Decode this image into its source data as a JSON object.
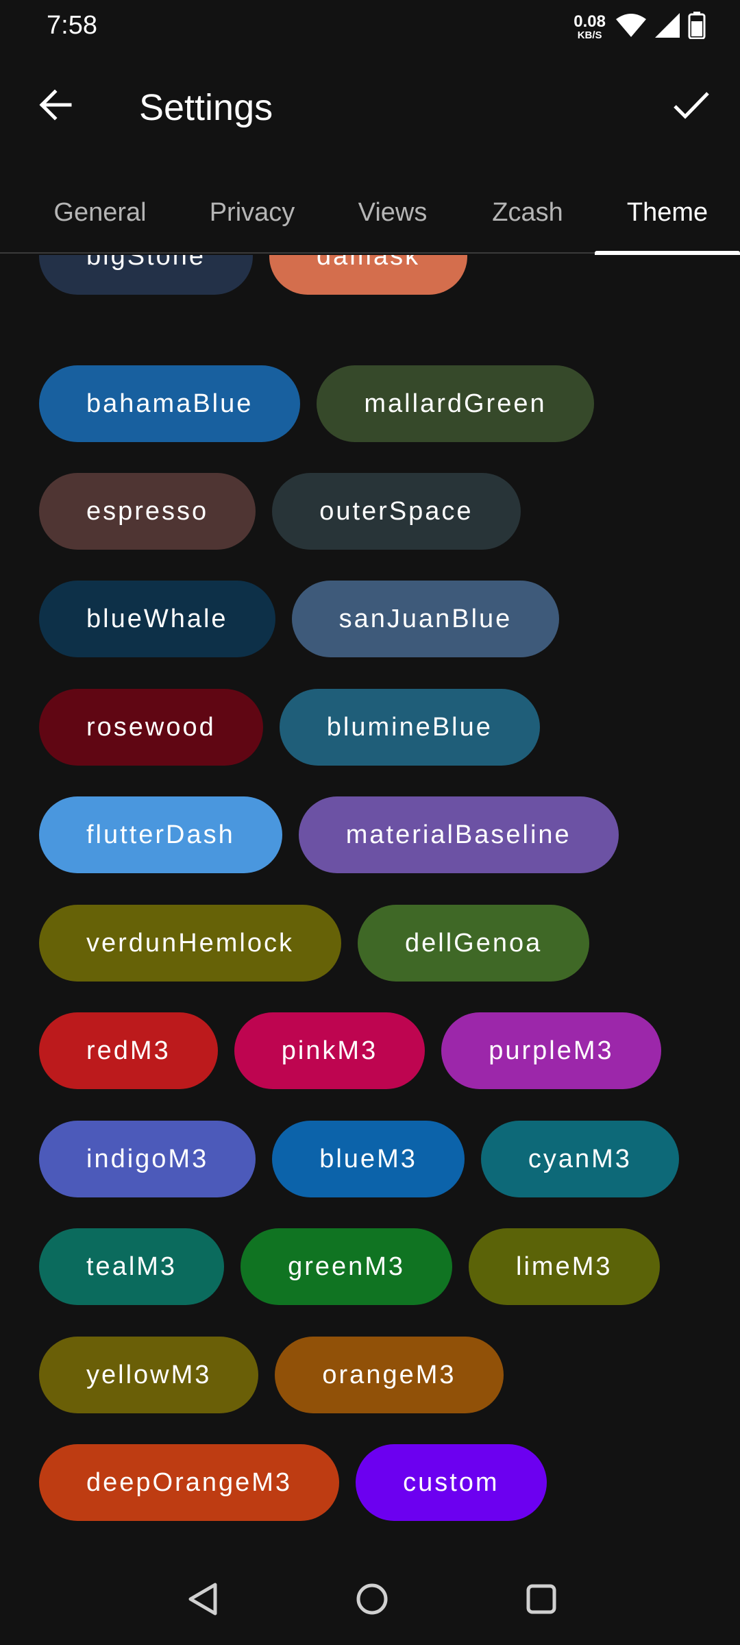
{
  "status_bar": {
    "time": "7:58",
    "net_speed_value": "0.08",
    "net_speed_unit": "KB/S",
    "icons": [
      "wifi-icon",
      "signal-icon",
      "battery-icon"
    ]
  },
  "app_bar": {
    "title": "Settings",
    "back_icon": "arrow-left-icon",
    "confirm_icon": "checkmark-icon"
  },
  "tabs": [
    {
      "label": "General",
      "active": false
    },
    {
      "label": "Privacy",
      "active": false
    },
    {
      "label": "Views",
      "active": false
    },
    {
      "label": "Zcash",
      "active": false
    },
    {
      "label": "Theme",
      "active": true
    }
  ],
  "themes": [
    {
      "label": "bigStone",
      "color": "#233148"
    },
    {
      "label": "damask",
      "color": "#D46E4D"
    },
    {
      "label": "bahamaBlue",
      "color": "#18609F"
    },
    {
      "label": "mallardGreen",
      "color": "#36492A"
    },
    {
      "label": "espresso",
      "color": "#4F3533"
    },
    {
      "label": "outerSpace",
      "color": "#283438"
    },
    {
      "label": "blueWhale",
      "color": "#0D3048"
    },
    {
      "label": "sanJuanBlue",
      "color": "#3E5A7A"
    },
    {
      "label": "rosewood",
      "color": "#600613"
    },
    {
      "label": "blumineBlue",
      "color": "#1F5E79"
    },
    {
      "label": "flutterDash",
      "color": "#4A97DE"
    },
    {
      "label": "materialBaseline",
      "color": "#6C52A4"
    },
    {
      "label": "verdunHemlock",
      "color": "#666207"
    },
    {
      "label": "dellGenoa",
      "color": "#3F6826"
    },
    {
      "label": "redM3",
      "color": "#BC1A1C"
    },
    {
      "label": "pinkM3",
      "color": "#BE0550"
    },
    {
      "label": "purpleM3",
      "color": "#9C27AA"
    },
    {
      "label": "indigoM3",
      "color": "#4C5ABA"
    },
    {
      "label": "blueM3",
      "color": "#0C63AA"
    },
    {
      "label": "cyanM3",
      "color": "#0D6978"
    },
    {
      "label": "tealM3",
      "color": "#0B6B5D"
    },
    {
      "label": "greenM3",
      "color": "#107422"
    },
    {
      "label": "limeM3",
      "color": "#5B6308"
    },
    {
      "label": "yellowM3",
      "color": "#6A5F07"
    },
    {
      "label": "orangeM3",
      "color": "#915108"
    },
    {
      "label": "deepOrangeM3",
      "color": "#BE3C12"
    },
    {
      "label": "custom",
      "color": "#6C00F0"
    }
  ],
  "nav_bar": {
    "icons": [
      "back-triangle-icon",
      "home-circle-icon",
      "recents-square-icon"
    ]
  }
}
